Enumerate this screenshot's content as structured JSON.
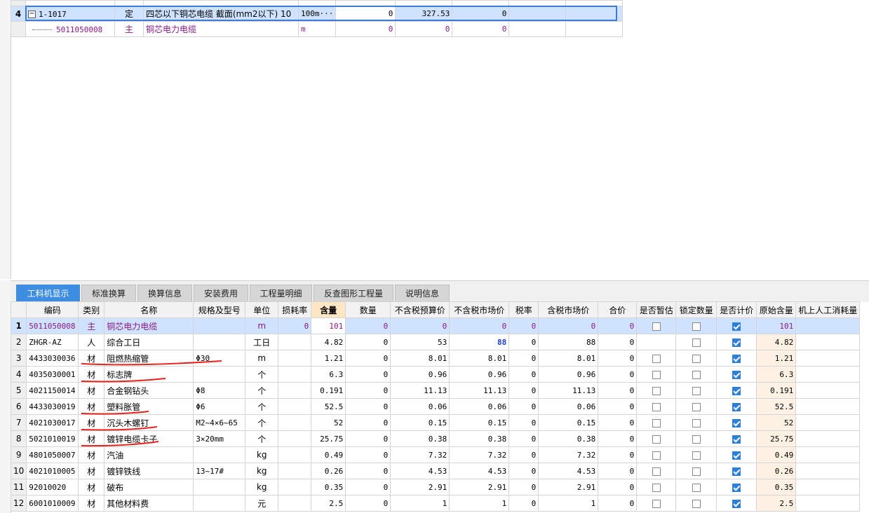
{
  "top_grid": {
    "rows": [
      {
        "num": "4",
        "code": "1-1017",
        "type": "定",
        "name": "四芯以下铜芯电缆 截面(mm2以下) 10",
        "unit": "100m···",
        "qty": "0",
        "price": "327.53",
        "total": "0"
      },
      {
        "num": "",
        "code": "5011050008",
        "type": "主",
        "name": "铜芯电力电缆",
        "unit": "m",
        "qty": "0",
        "price": "0",
        "total": "0"
      }
    ],
    "tree_toggle": "−"
  },
  "tabs": [
    "工料机显示",
    "标准换算",
    "换算信息",
    "安装费用",
    "工程量明细",
    "反查图形工程量",
    "说明信息"
  ],
  "resource_grid": {
    "headers": [
      "编码",
      "类别",
      "名称",
      "规格及型号",
      "单位",
      "损耗率",
      "含量",
      "数量",
      "不含税预算价",
      "不含税市场价",
      "税率",
      "含税市场价",
      "合价",
      "是否暂估",
      "锁定数量",
      "是否计价",
      "原始含量",
      "机上人工消耗量"
    ],
    "rows": [
      {
        "n": "1",
        "code": "5011050008",
        "cat": "主",
        "name": "铜芯电力电缆",
        "spec": "",
        "unit": "m",
        "loss": "0",
        "content": "101",
        "qty": "0",
        "budget": "0",
        "market": "0",
        "tax": "0",
        "taxmarket": "0",
        "total": "0",
        "est": false,
        "lock": false,
        "priced": true,
        "orig": "101"
      },
      {
        "n": "2",
        "code": "ZHGR-AZ",
        "cat": "人",
        "name": "综合工日",
        "spec": "",
        "unit": "工日",
        "loss": "",
        "content": "4.82",
        "qty": "0",
        "budget": "53",
        "market": "88",
        "tax": "0",
        "taxmarket": "88",
        "total": "0",
        "est": null,
        "lock": false,
        "priced": true,
        "orig": "4.82"
      },
      {
        "n": "3",
        "code": "4433030036",
        "cat": "材",
        "name": "阻燃热缩管",
        "spec": "Φ30",
        "unit": "m",
        "loss": "",
        "content": "1.21",
        "qty": "0",
        "budget": "8.01",
        "market": "8.01",
        "tax": "0",
        "taxmarket": "8.01",
        "total": "0",
        "est": false,
        "lock": false,
        "priced": true,
        "orig": "1.21"
      },
      {
        "n": "4",
        "code": "4035030001",
        "cat": "材",
        "name": "标志牌",
        "spec": "",
        "unit": "个",
        "loss": "",
        "content": "6.3",
        "qty": "0",
        "budget": "0.96",
        "market": "0.96",
        "tax": "0",
        "taxmarket": "0.96",
        "total": "0",
        "est": false,
        "lock": false,
        "priced": true,
        "orig": "6.3"
      },
      {
        "n": "5",
        "code": "4021150014",
        "cat": "材",
        "name": "合金钢钻头",
        "spec": "Φ8",
        "unit": "个",
        "loss": "",
        "content": "0.191",
        "qty": "0",
        "budget": "11.13",
        "market": "11.13",
        "tax": "0",
        "taxmarket": "11.13",
        "total": "0",
        "est": false,
        "lock": false,
        "priced": true,
        "orig": "0.191"
      },
      {
        "n": "6",
        "code": "4433030019",
        "cat": "材",
        "name": "塑料胀管",
        "spec": "Φ6",
        "unit": "个",
        "loss": "",
        "content": "52.5",
        "qty": "0",
        "budget": "0.06",
        "market": "0.06",
        "tax": "0",
        "taxmarket": "0.06",
        "total": "0",
        "est": false,
        "lock": false,
        "priced": true,
        "orig": "52.5"
      },
      {
        "n": "7",
        "code": "4021030017",
        "cat": "材",
        "name": "沉头木螺钉",
        "spec": "M2~4×6~65",
        "unit": "个",
        "loss": "",
        "content": "52",
        "qty": "0",
        "budget": "0.15",
        "market": "0.15",
        "tax": "0",
        "taxmarket": "0.15",
        "total": "0",
        "est": false,
        "lock": false,
        "priced": true,
        "orig": "52"
      },
      {
        "n": "8",
        "code": "5021010019",
        "cat": "材",
        "name": "镀锌电缆卡子",
        "spec": "3×20mm",
        "unit": "个",
        "loss": "",
        "content": "25.75",
        "qty": "0",
        "budget": "0.38",
        "market": "0.38",
        "tax": "0",
        "taxmarket": "0.38",
        "total": "0",
        "est": false,
        "lock": false,
        "priced": true,
        "orig": "25.75"
      },
      {
        "n": "9",
        "code": "4801050007",
        "cat": "材",
        "name": "汽油",
        "spec": "",
        "unit": "kg",
        "loss": "",
        "content": "0.49",
        "qty": "0",
        "budget": "7.32",
        "market": "7.32",
        "tax": "0",
        "taxmarket": "7.32",
        "total": "0",
        "est": false,
        "lock": false,
        "priced": true,
        "orig": "0.49"
      },
      {
        "n": "10",
        "code": "4021010005",
        "cat": "材",
        "name": "镀锌铁线",
        "spec": "13~17#",
        "unit": "kg",
        "loss": "",
        "content": "0.26",
        "qty": "0",
        "budget": "4.53",
        "market": "4.53",
        "tax": "0",
        "taxmarket": "4.53",
        "total": "0",
        "est": false,
        "lock": false,
        "priced": true,
        "orig": "0.26"
      },
      {
        "n": "11",
        "code": "92010020",
        "cat": "材",
        "name": "破布",
        "spec": "",
        "unit": "kg",
        "loss": "",
        "content": "0.35",
        "qty": "0",
        "budget": "2.91",
        "market": "2.91",
        "tax": "0",
        "taxmarket": "2.91",
        "total": "0",
        "est": false,
        "lock": false,
        "priced": true,
        "orig": "0.35"
      },
      {
        "n": "12",
        "code": "6001010009",
        "cat": "材",
        "name": "其他材料费",
        "spec": "",
        "unit": "元",
        "loss": "",
        "content": "2.5",
        "qty": "0",
        "budget": "1",
        "market": "1",
        "tax": "0",
        "taxmarket": "1",
        "total": "0",
        "est": false,
        "lock": false,
        "priced": true,
        "orig": "2.5"
      }
    ]
  },
  "colors": {
    "accent": "#3d8de0",
    "selected_row": "#cfe2ff",
    "material_text": "#8b1a8b",
    "annotation": "#e8231c"
  }
}
